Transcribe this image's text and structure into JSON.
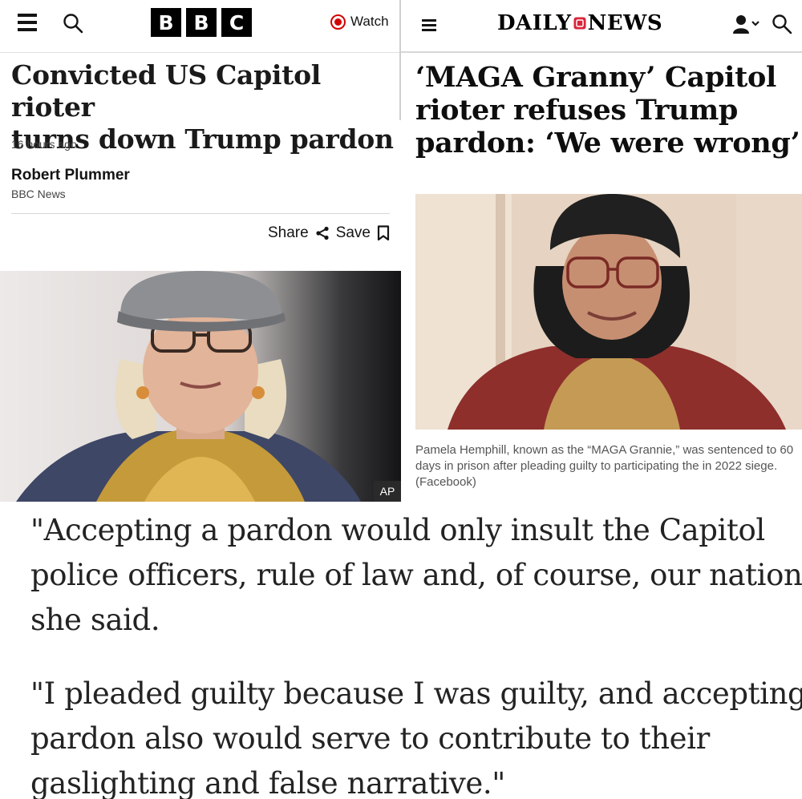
{
  "bbc": {
    "logo_letters": [
      "B",
      "B",
      "C"
    ],
    "watch_label": "Watch",
    "headline_lines": [
      "Convicted US Capitol rioter",
      "turns down Trump pardon"
    ],
    "timestamp": "16 hours ago",
    "author": "Robert Plummer",
    "organization": "BBC News",
    "share_label": "Share",
    "save_label": "Save",
    "photo_credit": "AP",
    "icons": [
      "hamburger-menu-icon",
      "search-icon",
      "watch-live-icon",
      "share-icon",
      "bookmark-icon"
    ],
    "colors": {
      "live_red": "#d30000",
      "logo_black": "#000000"
    }
  },
  "dailynews": {
    "logo_left": "DAILY",
    "logo_right": "NEWS",
    "headline_lines": [
      "‘MAGA Granny’ Capitol",
      "rioter refuses Trump",
      "pardon: ‘We were wrong’"
    ],
    "caption_lines": [
      "Pamela Hemphill, known as the “MAGA Grannie,” was sentenced to 60",
      "days in prison after pleading guilty to participating the in 2022 siege.",
      "(Facebook)"
    ],
    "icons": [
      "menu-icon",
      "user-icon",
      "chevron-down-icon",
      "search-icon"
    ],
    "colors": {
      "logo_accent": "#d9263b"
    }
  },
  "quotes": {
    "first_lines": [
      "\"Accepting a pardon would only insult the Capitol",
      "police officers, rule of law and, of course, our nation,\"",
      "she said."
    ],
    "second_lines": [
      "\"I pleaded guilty because I was guilty, and accepting a",
      "pardon also would serve to contribute to their",
      "gaslighting and false narrative.\""
    ]
  }
}
